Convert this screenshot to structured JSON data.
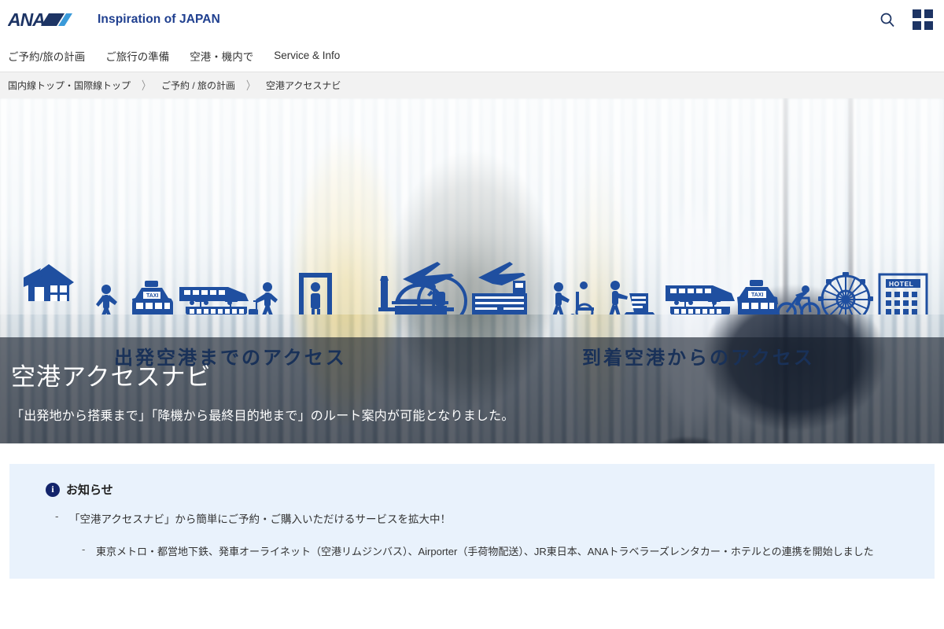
{
  "header": {
    "brand": "ANA",
    "tagline": "Inspiration of JAPAN",
    "search_icon": "search-icon",
    "grid_icon": "grid-menu-icon",
    "brand_color": "#1d3464",
    "accent_color": "#3a9ad9"
  },
  "gnav": {
    "items": [
      {
        "label": "ご予約/旅の計画"
      },
      {
        "label": "ご旅行の準備"
      },
      {
        "label": "空港・機内で"
      },
      {
        "label": "Service & Info"
      }
    ]
  },
  "breadcrumb": {
    "separator": "〉",
    "items": [
      {
        "label": "国内線トップ・国際線トップ"
      },
      {
        "label": "ご予約 / 旅の計画"
      },
      {
        "label": "空港アクセスナビ"
      }
    ]
  },
  "hero": {
    "title": "空港アクセスナビ",
    "subtitle": "「出発地から搭乗まで」「降機から最終目的地まで」のルート案内が可能となりました。",
    "left_caption": "出発空港までのアクセス",
    "right_caption": "到着空港からのアクセス",
    "illustration_color": "#1f4fa0",
    "left_icons": [
      "house-icon",
      "walking-person-icon",
      "taxi-icon",
      "bus-icon",
      "shinkansen-icon",
      "local-train-icon",
      "traveler-with-luggage-icon",
      "security-gate-icon"
    ],
    "center_icons": [
      "departure-airport-icon",
      "airplane-icon",
      "cabin-seat-icon",
      "arrival-airport-icon"
    ],
    "right_icons": [
      "wheelchair-assist-icon",
      "baggage-claim-icon",
      "shinkansen-icon",
      "local-train-icon",
      "taxi-icon",
      "bus-icon",
      "bicycle-icon",
      "ferris-wheel-icon",
      "hotel-icon"
    ],
    "hotel_sign": "HOTEL",
    "taxi_sign": "TAXI"
  },
  "notice": {
    "icon": "info-icon",
    "title": "お知らせ",
    "bullet": "-",
    "line1": "「空港アクセスナビ」から簡単にご予約・ご購入いただけるサービスを拡大中！",
    "line2": "東京メトロ・都営地下鉄、発車オーライネット（空港リムジンバス）、Airporter（手荷物配送）、JR東日本、ANAトラベラーズレンタカー・ホテルとの連携を開始しました",
    "bg_color": "#e9f2fc"
  }
}
